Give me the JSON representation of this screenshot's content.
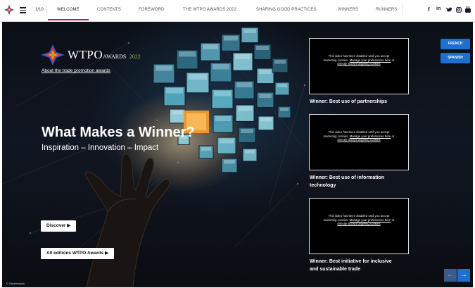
{
  "nav": {
    "pager": "1/10",
    "tabs": [
      "WELCOME",
      "CONTENTS",
      "FOREWORD",
      "THE WTPO AWARDS 2022",
      "SHARING GOOD PRACTICES",
      "WINNERS",
      "RUNNERS"
    ],
    "active_tab": "WELCOME",
    "social": [
      "f",
      "in",
      "♥",
      "◎",
      "▣"
    ],
    "social_names": [
      "facebook-icon",
      "linkedin-icon",
      "twitter-icon",
      "instagram-icon",
      "youtube-icon"
    ]
  },
  "brand": {
    "name": "WTPO",
    "suffix": "AWARDS",
    "year": "2022",
    "about_link": "About the trade promotion awards"
  },
  "hero": {
    "headline": "What Makes a Winner?",
    "subline": "Inspiration – Innovation – Impact",
    "discover_button": "Discover ▶",
    "editions_button": "All editions WTPO Awards ▶",
    "copyright": "© Shutterstock"
  },
  "video_message": {
    "line1": "This video has been disabled until you",
    "line2": "accept marketing cookies.",
    "manage_link": "Manage your preferences here",
    "or_text": "or",
    "accept_link": "directly accept targeting cookies"
  },
  "videos": [
    {
      "caption": "Winner: Best use of partnerships"
    },
    {
      "caption": "Winner: Best use of information technology"
    },
    {
      "caption": "Winner: Best initiative for inclusive and sustainable trade"
    }
  ],
  "languages": [
    "FRENCH",
    "SPANISH"
  ],
  "pagination": {
    "prev": "←",
    "next": "→"
  },
  "colors": {
    "accent_tab_underline": "#c2185b",
    "language_button": "#1e6fd0",
    "brand_year": "#8bc34a"
  }
}
